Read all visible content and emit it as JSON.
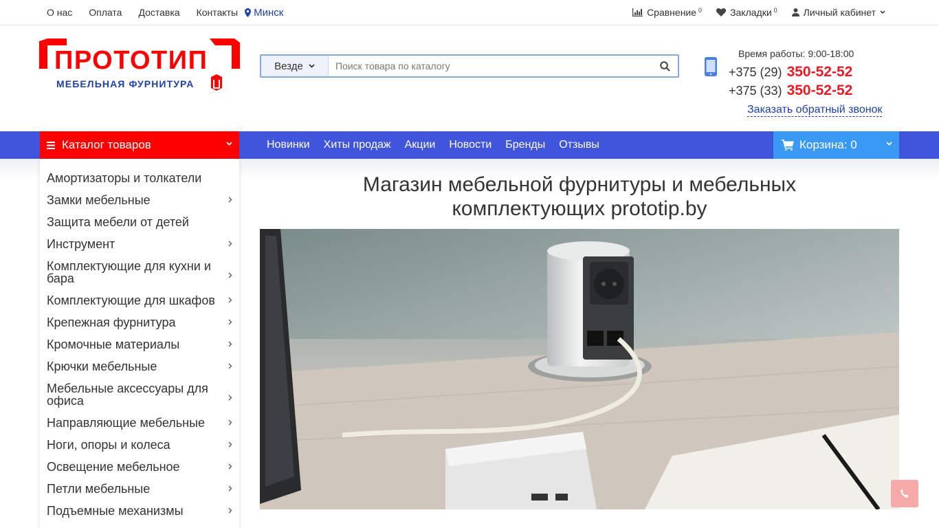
{
  "topbar": {
    "links": [
      "О нас",
      "Оплата",
      "Доставка",
      "Контакты"
    ],
    "city": "Минск",
    "compare": {
      "label": "Сравнение",
      "count": "0"
    },
    "bookmarks": {
      "label": "Закладки",
      "count": "0"
    },
    "account": "Личный кабинет"
  },
  "logo": {
    "title": "ПРОТОТИП",
    "subtitle": "МЕБЕЛЬНАЯ ФУРНИТУРА"
  },
  "search": {
    "scope": "Везде",
    "placeholder": "Поиск товара по каталогу"
  },
  "contacts": {
    "worktime": "Время работы: 9:00-18:00",
    "phones": [
      {
        "prefix": "+375 (29)",
        "number": "350-52-52"
      },
      {
        "prefix": "+375 (33)",
        "number": "350-52-52"
      }
    ],
    "callback": "Заказать обратный звонок"
  },
  "nav": {
    "catalog": "Каталог товаров",
    "items": [
      "Новинки",
      "Хиты продаж",
      "Акции",
      "Новости",
      "Бренды",
      "Отзывы"
    ],
    "cart": "Корзина: 0"
  },
  "categories": [
    {
      "label": "Амортизаторы и толкатели",
      "has_sub": false
    },
    {
      "label": "Замки мебельные",
      "has_sub": true
    },
    {
      "label": "Защита мебели от детей",
      "has_sub": false
    },
    {
      "label": "Инструмент",
      "has_sub": true
    },
    {
      "label": "Комплектующие для кухни и бара",
      "has_sub": true
    },
    {
      "label": "Комплектующие для шкафов",
      "has_sub": true
    },
    {
      "label": "Крепежная фурнитура",
      "has_sub": true
    },
    {
      "label": "Кромочные материалы",
      "has_sub": true
    },
    {
      "label": "Крючки мебельные",
      "has_sub": true
    },
    {
      "label": "Мебельные аксессуары для офиса",
      "has_sub": true
    },
    {
      "label": "Направляющие мебельные",
      "has_sub": true
    },
    {
      "label": "Ноги, опоры и колеса",
      "has_sub": true
    },
    {
      "label": "Освещение мебельное",
      "has_sub": true
    },
    {
      "label": "Петли мебельные",
      "has_sub": true
    },
    {
      "label": "Подъемные механизмы",
      "has_sub": true
    }
  ],
  "main": {
    "title_line1": "Магазин мебельной фурнитуры и мебельных",
    "title_line2": "комплектующих prototip.by"
  },
  "colors": {
    "brand_red": "#ff0000",
    "brand_blue": "#4155dc",
    "cart_blue": "#3a99f2",
    "phone_red": "#e61c24"
  }
}
